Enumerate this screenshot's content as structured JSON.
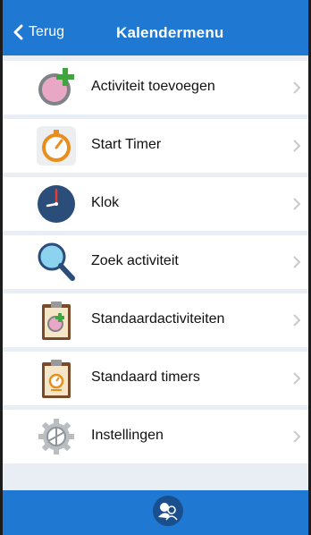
{
  "header": {
    "back_label": "Terug",
    "title": "Kalendermenu"
  },
  "menu": {
    "items": [
      {
        "label": "Activiteit toevoegen",
        "icon": "add-activity-icon"
      },
      {
        "label": "Start Timer",
        "icon": "timer-icon"
      },
      {
        "label": "Klok",
        "icon": "clock-icon"
      },
      {
        "label": "Zoek activiteit",
        "icon": "search-icon"
      },
      {
        "label": "Standaardactiviteiten",
        "icon": "clipboard-activity-icon"
      },
      {
        "label": "Standaard timers",
        "icon": "clipboard-timer-icon"
      },
      {
        "label": "Instellingen",
        "icon": "gear-icon"
      }
    ]
  },
  "footer": {
    "button_icon": "users-icon"
  },
  "colors": {
    "accent": "#1f78d1",
    "background": "#e9eef4",
    "footer_button": "#1a4f8e"
  }
}
